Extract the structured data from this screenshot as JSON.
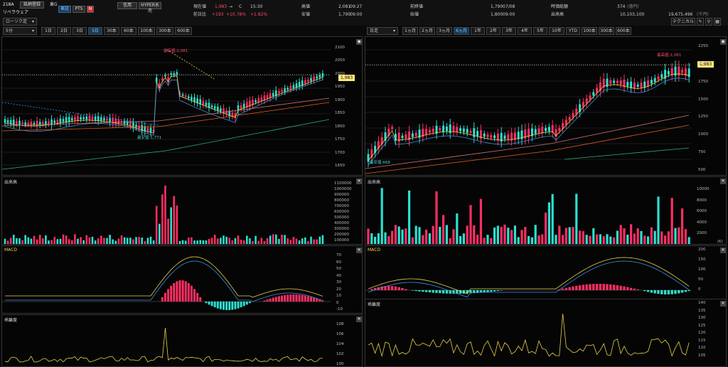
{
  "header": {
    "code": "218A",
    "name": "リベラウェア",
    "register_btn": "銘柄登録",
    "market": "東G",
    "btn_tosho": "東証",
    "btn_pts": "PTS",
    "btn_n": "N",
    "btn_shinyo": "信用",
    "btn_hyper": "HYPER水売",
    "current_label": "現在値",
    "current_value": "1,983",
    "arrow": "→",
    "c_mark": "C",
    "time": "15:30",
    "prevdiff_label": "前日比",
    "diff": "+193",
    "diff_pct": "+10.78%",
    "diff_pct2": "+1.82%",
    "high_label": "高値",
    "high_value": "2,081",
    "high_time": "09:27",
    "low_label": "安値",
    "low_value": "1,790",
    "low_time": "09:00",
    "prevclose_label": "前終値",
    "prevclose_value": "1,790",
    "prevclose_date": "07/08",
    "open_label": "始値",
    "open_value": "1,800",
    "open_time": "09:00",
    "mcap_label": "時価総額",
    "mcap_value": "374",
    "mcap_unit": "(億円)",
    "volume_label": "出来高",
    "volume_value": "10,103,100",
    "turnover_value": "19,675,496",
    "turnover_unit": "(千円)"
  },
  "left": {
    "interval_select": "5分",
    "chart_type_select": "ローソク足",
    "ranges": [
      "1日",
      "2日",
      "3日",
      "5日",
      "30本",
      "60本",
      "100本",
      "300本",
      "600本"
    ],
    "selected_range": "5日",
    "high_note": "最高値:2,081",
    "low_note": "最安値:1,771",
    "price_tag": "1,983",
    "y_ticks": [
      "2100",
      "2050",
      "2000",
      "1950",
      "1900",
      "1850",
      "1800",
      "1750",
      "1700",
      "1650"
    ],
    "volume_title": "出来高",
    "volume_ticks": [
      "1100000",
      "1000000",
      "900000",
      "800000",
      "700000",
      "600000",
      "500000",
      "400000",
      "300000",
      "200000",
      "100000"
    ],
    "macd_title": "MACD",
    "macd_ticks": [
      "70",
      "60",
      "50",
      "40",
      "30",
      "20",
      "10",
      "0",
      "-10"
    ],
    "div_title": "乖離度",
    "div_ticks": [
      "108",
      "106",
      "104",
      "102",
      "100"
    ]
  },
  "right": {
    "chart_type_select": "日足",
    "ranges": [
      "1ヵ月",
      "2ヵ月",
      "3ヵ月",
      "6ヵ月",
      "1年",
      "2年",
      "3年",
      "4年",
      "5年",
      "10年",
      "YTD",
      "100本",
      "300本",
      "600本"
    ],
    "selected_range": "6ヵ月",
    "technical_btn": "テクニカル",
    "high_note": "最高値:2,081",
    "low_note": "最安値:668",
    "price_tag": "1,983",
    "y_ticks": [
      "2250",
      "2000",
      "1750",
      "1500",
      "1250",
      "1000",
      "750",
      "500"
    ],
    "volume_title": "出来高",
    "volume_ticks": [
      "10000",
      "8000",
      "6000",
      "4000",
      "2000"
    ],
    "volume_unit": "(K)",
    "macd_title": "MACD",
    "macd_ticks": [
      "200",
      "150",
      "100",
      "50",
      "0"
    ],
    "div_title": "乖離度",
    "div_ticks": [
      "140",
      "135",
      "130",
      "125",
      "120",
      "115",
      "110",
      "105"
    ]
  }
}
